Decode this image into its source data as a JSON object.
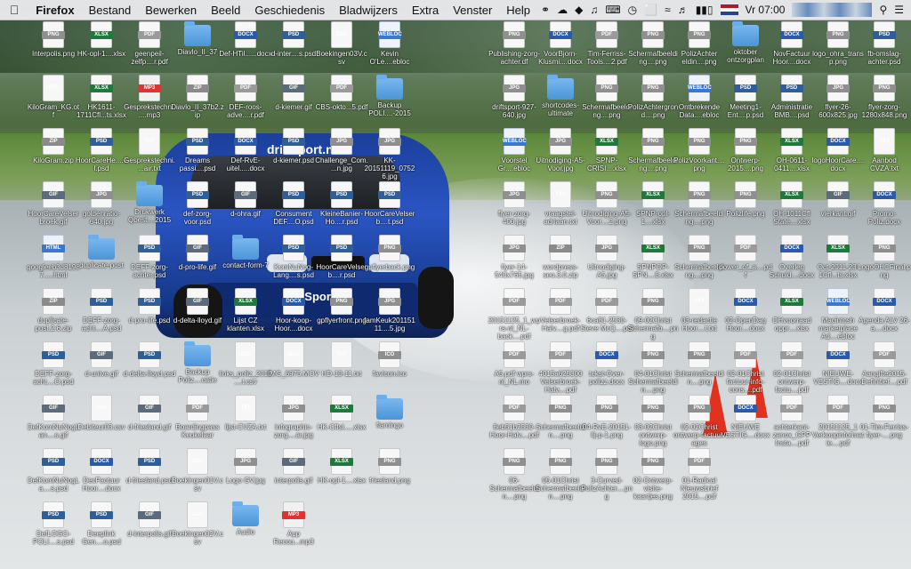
{
  "menubar": {
    "apple": "",
    "items": [
      "Firefox",
      "Bestand",
      "Bewerken",
      "Beeld",
      "Geschiedenis",
      "Bladwijzers",
      "Extra",
      "Venster",
      "Help"
    ],
    "clock": "Vr 07:00"
  },
  "wallpaper": {
    "brand": "driftsport.nl",
    "plate": "iftSport.nl"
  },
  "desktop": {
    "icons": [
      {
        "label": "Interpolis.png",
        "type": "png",
        "tag": "PNG"
      },
      {
        "label": "HK-opl-1....xlsx",
        "type": "xlsx",
        "tag": "XLSX"
      },
      {
        "label": "geenpeil-zelfp....r.pdf",
        "type": "pdf",
        "tag": "PDF"
      },
      {
        "label": "Diavlo_II_37",
        "type": "folder",
        "tag": ""
      },
      {
        "label": "Def-HTil......docx",
        "type": "docx",
        "tag": "DOCX"
      },
      {
        "label": "d-inter....s.psd",
        "type": "psd",
        "tag": "PSD"
      },
      {
        "label": "Boekingen03V.csv",
        "type": "csv",
        "tag": "CSV"
      },
      {
        "label": "Kevin O'Le....ebloc",
        "type": "webloc",
        "tag": "WEBLOC"
      },
      {
        "label": "KiloGram_KG.otf",
        "type": "otf",
        "tag": "OTF"
      },
      {
        "label": "HK1611-1711Cfl...ts.xlsx",
        "type": "xlsx",
        "tag": "XLSX"
      },
      {
        "label": "Gesprekstechni.....mp3",
        "type": "mp3",
        "tag": "MP3"
      },
      {
        "label": "Diavlo_II_37b2.zip",
        "type": "zip",
        "tag": "ZIP"
      },
      {
        "label": "DEF-roos-adve....r.pdf",
        "type": "pdf",
        "tag": "PDF"
      },
      {
        "label": "d-kiemer.gif",
        "type": "gif",
        "tag": "GIF"
      },
      {
        "label": "CBS-okto...5.pdf",
        "type": "pdf",
        "tag": "PDF"
      },
      {
        "label": "Backup POLI....-2015",
        "type": "folder",
        "tag": ""
      },
      {
        "label": "KiloGram.zip",
        "type": "zip",
        "tag": "ZIP"
      },
      {
        "label": "HoorCareHe....el.psd",
        "type": "psd",
        "tag": "PSD"
      },
      {
        "label": "Gesprekstechni....air.txt",
        "type": "txt",
        "tag": "TXT"
      },
      {
        "label": "Dreams passi....psd",
        "type": "psd",
        "tag": "PSD"
      },
      {
        "label": "Def-RvE-uitel.....docx",
        "type": "docx",
        "tag": "DOCX"
      },
      {
        "label": "d-kiemer.psd",
        "type": "psd",
        "tag": "PSD"
      },
      {
        "label": "Challenge_Com....n.jpg",
        "type": "png",
        "tag": "JPG"
      },
      {
        "label": "KK-20151119_07526.jpg",
        "type": "png",
        "tag": "JPG"
      },
      {
        "label": "HoorCareVelserbroek.gif",
        "type": "gif",
        "tag": "GIF"
      },
      {
        "label": "goldenratio-640.jpg",
        "type": "png",
        "tag": "JPG"
      },
      {
        "label": "Drukwerk Qbest....2015",
        "type": "folder",
        "tag": ""
      },
      {
        "label": "def-zorg-voor.psd",
        "type": "psd",
        "tag": "PSD"
      },
      {
        "label": "d-ohra.gif",
        "type": "gif",
        "tag": "GIF"
      },
      {
        "label": "Consument DEF....O.psd",
        "type": "psd",
        "tag": "PSD"
      },
      {
        "label": "KleineBanier-Ho....r.psd",
        "type": "psd",
        "tag": "PSD"
      },
      {
        "label": "HoorCareVelserb....t.psd",
        "type": "psd",
        "tag": "PSD"
      },
      {
        "label": "googleeb3d81987.....html",
        "type": "webloc",
        "tag": "HTML"
      },
      {
        "label": "duplicate-post",
        "type": "folder",
        "tag": ""
      },
      {
        "label": "DEFF-zorg-achter.psd",
        "type": "psd",
        "tag": "PSD"
      },
      {
        "label": "d-pro-life.gif",
        "type": "gif",
        "tag": "GIF"
      },
      {
        "label": "contact-form-7",
        "type": "folder",
        "tag": ""
      },
      {
        "label": "KomNuNog-Lang....s.psd",
        "type": "psd",
        "tag": "PSD"
      },
      {
        "label": "HoorCareVelserb....r.psd",
        "type": "psd",
        "tag": "PSD"
      },
      {
        "label": "gpflyerback.png",
        "type": "png",
        "tag": "PNG"
      },
      {
        "label": "duplicate-post.2.6.zip",
        "type": "zip",
        "tag": "ZIP"
      },
      {
        "label": "DEFF-zorg-acht....A.psd",
        "type": "psd",
        "tag": "PSD"
      },
      {
        "label": "d-pro-life.psd",
        "type": "psd",
        "tag": "PSD"
      },
      {
        "label": "d-delta-lloyd.gif",
        "type": "gif",
        "tag": "GIF"
      },
      {
        "label": "Lijst CZ klanten.xlsx",
        "type": "xlsx",
        "tag": "XLSX"
      },
      {
        "label": "Hoor-koop-Hoor....docx",
        "type": "docx",
        "tag": "DOCX"
      },
      {
        "label": "gpflyerfront.png",
        "type": "png",
        "tag": "PNG"
      },
      {
        "label": "famKeuk20115111....5.jpg",
        "type": "png",
        "tag": "JPG"
      },
      {
        "label": "DEFF-zorg-acht....O.psd",
        "type": "psd",
        "tag": "PSD"
      },
      {
        "label": "d-unive.gif",
        "type": "gif",
        "tag": "GIF"
      },
      {
        "label": "d-delta-lloyd.psd",
        "type": "psd",
        "tag": "PSD"
      },
      {
        "label": "Backup Poliz....catie",
        "type": "folder",
        "tag": ""
      },
      {
        "label": "links_poliz_2015....t.csv",
        "type": "csv",
        "tag": "CSV"
      },
      {
        "label": "IMG_6975.MOV",
        "type": "mov",
        "tag": "MOV"
      },
      {
        "label": "HD-10-11.txt",
        "type": "txt",
        "tag": "TXT"
      },
      {
        "label": "favicon.ico",
        "type": "png",
        "tag": "ICO"
      },
      {
        "label": "DefKomNuNogLan....s.gif",
        "type": "gif",
        "tag": "GIF"
      },
      {
        "label": "Debiteur03.csv",
        "type": "csv",
        "tag": "CSV"
      },
      {
        "label": "d-friesland.gif",
        "type": "gif",
        "tag": "GIF"
      },
      {
        "label": "Boardingpass Keukelaar",
        "type": "pdf",
        "tag": "PDF"
      },
      {
        "label": "lijst-CVZA.txt",
        "type": "txt",
        "tag": "TXT"
      },
      {
        "label": "infographic-zorg....ar.jpg",
        "type": "png",
        "tag": "JPG"
      },
      {
        "label": "HK-CfIsl.....xlsx",
        "type": "xlsx",
        "tag": "XLSX"
      },
      {
        "label": "flamingo",
        "type": "folder",
        "tag": ""
      },
      {
        "label": "DefKomNuNogLa....s.psd",
        "type": "psd",
        "tag": "PSD"
      },
      {
        "label": "DecFactuur Hoor....docx",
        "type": "docx",
        "tag": "DOCX"
      },
      {
        "label": "d-friesland.psd",
        "type": "psd",
        "tag": "PSD"
      },
      {
        "label": "Boekingen01V.csv",
        "type": "csv",
        "tag": "CSV"
      },
      {
        "label": "Logo GV.jpg",
        "type": "png",
        "tag": "JPG"
      },
      {
        "label": "interpolis.gif",
        "type": "gif",
        "tag": "GIF"
      },
      {
        "label": "HK-opl-1....xlsx",
        "type": "xlsx",
        "tag": "XLSX"
      },
      {
        "label": "friesland.png",
        "type": "png",
        "tag": "PNG"
      },
      {
        "label": "DefLOGO-POLI....s.psd",
        "type": "psd",
        "tag": "PSD"
      },
      {
        "label": "Deeplink Gen....o.psd",
        "type": "psd",
        "tag": "PSD"
      },
      {
        "label": "d-interpolis.gif",
        "type": "gif",
        "tag": "GIF"
      },
      {
        "label": "Boekingen02V.csv",
        "type": "csv",
        "tag": "CSV"
      },
      {
        "label": "Audio",
        "type": "folder",
        "tag": ""
      },
      {
        "label": "App Recou...mp3",
        "type": "mp3",
        "tag": "MP3"
      },
      {
        "label": "Publishing-zorg-achter.df",
        "type": "png",
        "tag": "PNG"
      },
      {
        "label": "VoorBjorn-Klusmi....docx",
        "type": "docx",
        "tag": "DOCX"
      },
      {
        "label": "Tim-Ferriss-Tools....2.pdf",
        "type": "pdf",
        "tag": "PDF"
      },
      {
        "label": "Schermafbeelding....png",
        "type": "png",
        "tag": "PNG"
      },
      {
        "label": "PolizAchter eldin....png",
        "type": "png",
        "tag": "PNG"
      },
      {
        "label": "oktober ontzorgplan",
        "type": "folder",
        "tag": ""
      },
      {
        "label": "NovFactuur Hoor....docx",
        "type": "docx",
        "tag": "DOCX"
      },
      {
        "label": "logo_ohra_transp.png",
        "type": "png",
        "tag": "PNG"
      },
      {
        "label": "fb-omslag-achter.psd",
        "type": "psd",
        "tag": "PSD"
      },
      {
        "label": "driftsport-927-640.jpg",
        "type": "png",
        "tag": "JPG"
      },
      {
        "label": "shortcodes-ultimate",
        "type": "folder",
        "tag": ""
      },
      {
        "label": "Schermafbeelding....png",
        "type": "png",
        "tag": "PNG"
      },
      {
        "label": "PolizAchtergrond....png",
        "type": "png",
        "tag": "PNG"
      },
      {
        "label": "Ontbrekende Data....ebloc",
        "type": "webloc",
        "tag": "WEBLOC"
      },
      {
        "label": "Meeting1-Ent....p.psd",
        "type": "psd",
        "tag": "PSD"
      },
      {
        "label": "Administratie BMB....psd",
        "type": "psd",
        "tag": "PSD"
      },
      {
        "label": "flyer-26-600x825.jpg",
        "type": "png",
        "tag": "JPG"
      },
      {
        "label": "flyer-zorg-1280x848.png",
        "type": "png",
        "tag": "PNG"
      },
      {
        "label": "Voorstel Gr....ebloc",
        "type": "webloc",
        "tag": "WEBLOC"
      },
      {
        "label": "Uitnodiging-A5-Voor.jpg",
        "type": "png",
        "tag": "JPG"
      },
      {
        "label": "SPNP-CRISI....xlsx",
        "type": "xlsx",
        "tag": "XLSX"
      },
      {
        "label": "Schermafbeelding....png",
        "type": "png",
        "tag": "PNG"
      },
      {
        "label": "PolizVoorkant....png",
        "type": "png",
        "tag": "PNG"
      },
      {
        "label": "Ontwerp-2015....png",
        "type": "png",
        "tag": "PNG"
      },
      {
        "label": "OH-0611-0411....xlsx",
        "type": "xlsx",
        "tag": "XLSX"
      },
      {
        "label": "logoHoorCare....docx",
        "type": "docx",
        "tag": "DOCX"
      },
      {
        "label": "Aanbod CVZA.txt",
        "type": "txt",
        "tag": "TXT"
      },
      {
        "label": "flyer-zorg-400.jpg",
        "type": "png",
        "tag": "JPG"
      },
      {
        "label": "vraagstel-adriaan.txt",
        "type": "txt",
        "tag": "TXT"
      },
      {
        "label": "Uitnodiging-A5-Voor....2.png",
        "type": "png",
        "tag": "PNG"
      },
      {
        "label": "SPNP-opl-1....xlsx",
        "type": "xlsx",
        "tag": "XLSX"
      },
      {
        "label": "Schermafbeelding....png",
        "type": "png",
        "tag": "PNG"
      },
      {
        "label": "Polizlife.png",
        "type": "png",
        "tag": "PNG"
      },
      {
        "label": "OH-1011Cfl State....xlsx",
        "type": "xlsx",
        "tag": "XLSX"
      },
      {
        "label": "vierkant.gif",
        "type": "gif",
        "tag": "GIF"
      },
      {
        "label": "Promo-Poliz.docx",
        "type": "docx",
        "tag": "DOCX"
      },
      {
        "label": "flyer-14-540x765.jpg",
        "type": "png",
        "tag": "JPG"
      },
      {
        "label": "wordpress-seo.3.0.zip",
        "type": "zip",
        "tag": "ZIP"
      },
      {
        "label": "Uitnodiging-A5.jpg",
        "type": "png",
        "tag": "JPG"
      },
      {
        "label": "SPNPOP-SPN....8.xlsx",
        "type": "xlsx",
        "tag": "XLSX"
      },
      {
        "label": "Schermafbeelding....png",
        "type": "png",
        "tag": "PNG"
      },
      {
        "label": "power_of_a....pdf",
        "type": "pdf",
        "tag": "PDF"
      },
      {
        "label": "Overleg Schuld....docx",
        "type": "docx",
        "tag": "DOCX"
      },
      {
        "label": "Oct-2011-23-1Cfl...ts.xlsx",
        "type": "xlsx",
        "tag": "XLSX"
      },
      {
        "label": "LogoOHCFinal.png",
        "type": "png",
        "tag": "PNG"
      },
      {
        "label": "20151125_1_wprs-nl_NL-back....pdf",
        "type": "pdf",
        "tag": "PDF"
      },
      {
        "label": "Velserbroek-Halv....g.pdf",
        "type": "pdf",
        "tag": "PDF"
      },
      {
        "label": "6ca81-2530-Steve McQ....pdf",
        "type": "pdf",
        "tag": "PDF"
      },
      {
        "label": "09-02Christ Schermafb....png",
        "type": "png",
        "tag": "PNG"
      },
      {
        "label": "03-redactie Hoor....t.txt",
        "type": "txt",
        "tag": "TXT"
      },
      {
        "label": "02-OpenDag Hoor....docx",
        "type": "docx",
        "tag": "DOCX"
      },
      {
        "label": "OHvoorraad oppr....xlsx",
        "type": "xlsx",
        "tag": "XLSX"
      },
      {
        "label": "Macintosh marketplace Ad....ebloc",
        "type": "webloc",
        "tag": "WEBLOC"
      },
      {
        "label": "Agenda ALV 26-a....docx",
        "type": "docx",
        "tag": "DOCX"
      },
      {
        "label": "A5.pdf wprs-nl_NL.mo",
        "type": "pdf",
        "tag": "PDF"
      },
      {
        "label": "4015a625300 Velserbroek-Halv....pdf",
        "type": "pdf",
        "tag": "PDF"
      },
      {
        "label": "tekst-Over-polizz.docx",
        "type": "docx",
        "tag": "DOCX"
      },
      {
        "label": "04-01Christ Schermafbeeldin....png",
        "type": "png",
        "tag": "PNG"
      },
      {
        "label": "Schermafbeeldin....png",
        "type": "png",
        "tag": "PNG"
      },
      {
        "label": "02-01Christ factuur-info-cons....pdf",
        "type": "pdf",
        "tag": "PDF"
      },
      {
        "label": "02-01Christ ontwerp-factu....pdf",
        "type": "pdf",
        "tag": "PDF"
      },
      {
        "label": "NIEUWE-VESTIG....docx",
        "type": "docx",
        "tag": "DOCX"
      },
      {
        "label": "Aangifte2015-Definitief....pdf",
        "type": "pdf",
        "tag": "PDF"
      },
      {
        "label": "8eb51b2530-Hoor-Halv....pdf",
        "type": "pdf",
        "tag": "PDF"
      },
      {
        "label": "Schermafbeeldin....png",
        "type": "png",
        "tag": "PNG"
      },
      {
        "label": "04-RvE-20151-lij-p-1.png",
        "type": "png",
        "tag": "PNG"
      },
      {
        "label": "03-02Christ ontwerp-logo.png",
        "type": "png",
        "tag": "PNG"
      },
      {
        "label": "02-02Christ ontwerp-factuur-ages",
        "type": "png",
        "tag": "PNG"
      },
      {
        "label": "NIEUWE VESTIG....docx",
        "type": "docx",
        "tag": "DOCX"
      },
      {
        "label": "achterkant-zanox_GPP Insta....pdf",
        "type": "pdf",
        "tag": "PDF"
      },
      {
        "label": "20151125_1 Verkoopinformatie....pdf",
        "type": "pdf",
        "tag": "PDF"
      },
      {
        "label": "01-Tim-Ferriss-flyer-....png",
        "type": "png",
        "tag": "PNG"
      },
      {
        "label": "06-Schermafbeeldin....png",
        "type": "png",
        "tag": "PNG"
      },
      {
        "label": "05-01Christ Schermafbeeldin....png",
        "type": "png",
        "tag": "PNG"
      },
      {
        "label": "3-Curved-PolizAchter....png",
        "type": "png",
        "tag": "PNG"
      },
      {
        "label": "02-Ontwerp-visite-kaartjes.png",
        "type": "png",
        "tag": "PNG"
      },
      {
        "label": "01-Radical Nieuwsbrief 2015....pdf",
        "type": "pdf",
        "tag": "PDF"
      }
    ]
  }
}
